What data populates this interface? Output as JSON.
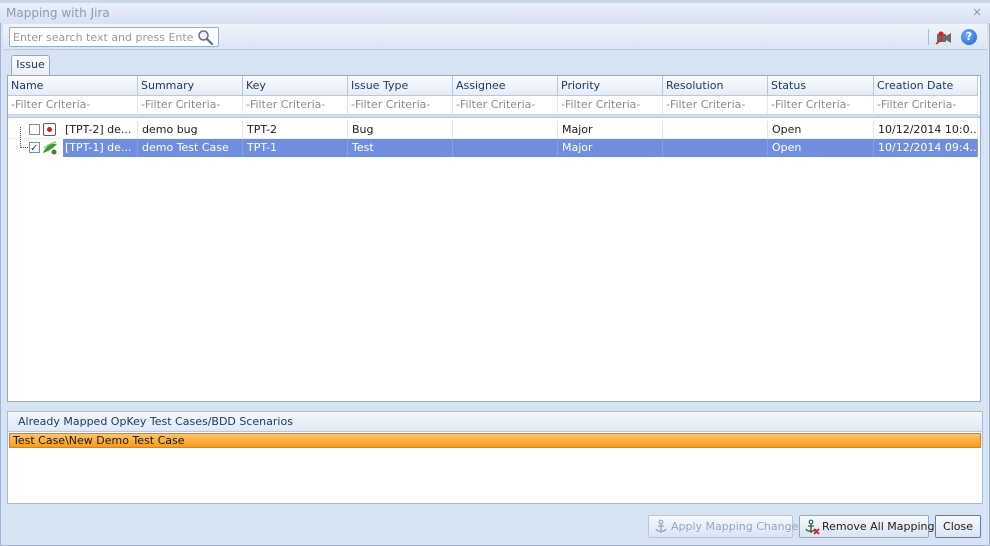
{
  "window": {
    "title": "Mapping with Jira",
    "close_glyph": "×"
  },
  "toolbar": {
    "search_placeholder": "Enter search text and press Enter",
    "search_icon": "search-icon",
    "record_icon": "record-video-icon",
    "help_icon": "help-icon",
    "help_glyph": "?"
  },
  "tabs": [
    {
      "label": "Issue"
    }
  ],
  "grid": {
    "columns": [
      "Name",
      "Summary",
      "Key",
      "Issue Type",
      "Assignee",
      "Priority",
      "Resolution",
      "Status",
      "Creation Date"
    ],
    "filter": "-Filter Criteria-",
    "rows": [
      {
        "checked": false,
        "icon": "bug-icon",
        "name": "[TPT-2] de...",
        "summary": "demo bug",
        "key": "TPT-2",
        "issue_type": "Bug",
        "assignee": "",
        "priority": "Major",
        "resolution": "",
        "status": "Open",
        "creation_date": "10/12/2014 10:0..."
      },
      {
        "checked": true,
        "selected": true,
        "icon": "test-case-icon",
        "name": "[TPT-1] de...",
        "summary": "demo Test Case",
        "key": "TPT-1",
        "issue_type": "Test",
        "assignee": "",
        "priority": "Major",
        "resolution": "",
        "status": "Open",
        "creation_date": "10/12/2014 09:4..."
      }
    ]
  },
  "mapped": {
    "header": "Already Mapped OpKey Test Cases/BDD Scenarios",
    "items": [
      "Test Case\\New Demo Test Case"
    ]
  },
  "buttons": {
    "apply": "Apply Mapping Changes",
    "remove_all": "Remove All Mappings",
    "close": "Close"
  },
  "colors": {
    "selection": "#6f8fde",
    "mapped_highlight": "#f79a1a",
    "accent": "#1e3a6a"
  }
}
